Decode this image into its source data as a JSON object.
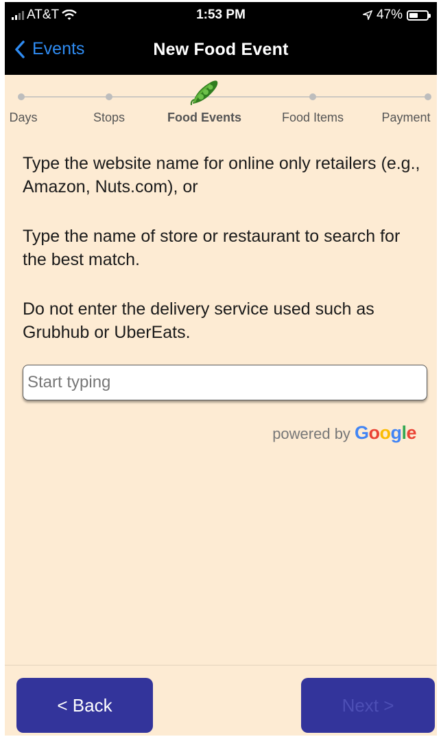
{
  "status_bar": {
    "carrier": "AT&T",
    "time": "1:53 PM",
    "battery": "47%",
    "icons": [
      "signal-icon",
      "wifi-icon",
      "location-arrow-icon",
      "battery-icon"
    ]
  },
  "nav": {
    "back_label": "Events",
    "title": "New Food Event"
  },
  "steps": [
    {
      "label": "Days",
      "active": false
    },
    {
      "label": "Stops",
      "active": false
    },
    {
      "label": "Food Events",
      "active": true
    },
    {
      "label": "Food Items",
      "active": false
    },
    {
      "label": "Payment",
      "active": false
    }
  ],
  "instructions": {
    "para1": "Type the website name for online only retailers (e.g., Amazon, Nuts.com), or",
    "para2": "Type the name of store or restaurant to search for the best match.",
    "para3": "Do not enter the delivery service used such as Grubhub or UberEats."
  },
  "search": {
    "placeholder": "Start typing",
    "value": ""
  },
  "attribution": {
    "prefix": "powered by",
    "brand": "Google"
  },
  "buttons": {
    "back": "< Back",
    "next": "Next >"
  },
  "colors": {
    "background": "#fdebd3",
    "header": "#000000",
    "accent_blue": "#2f8cf3",
    "button": "#33349b"
  }
}
